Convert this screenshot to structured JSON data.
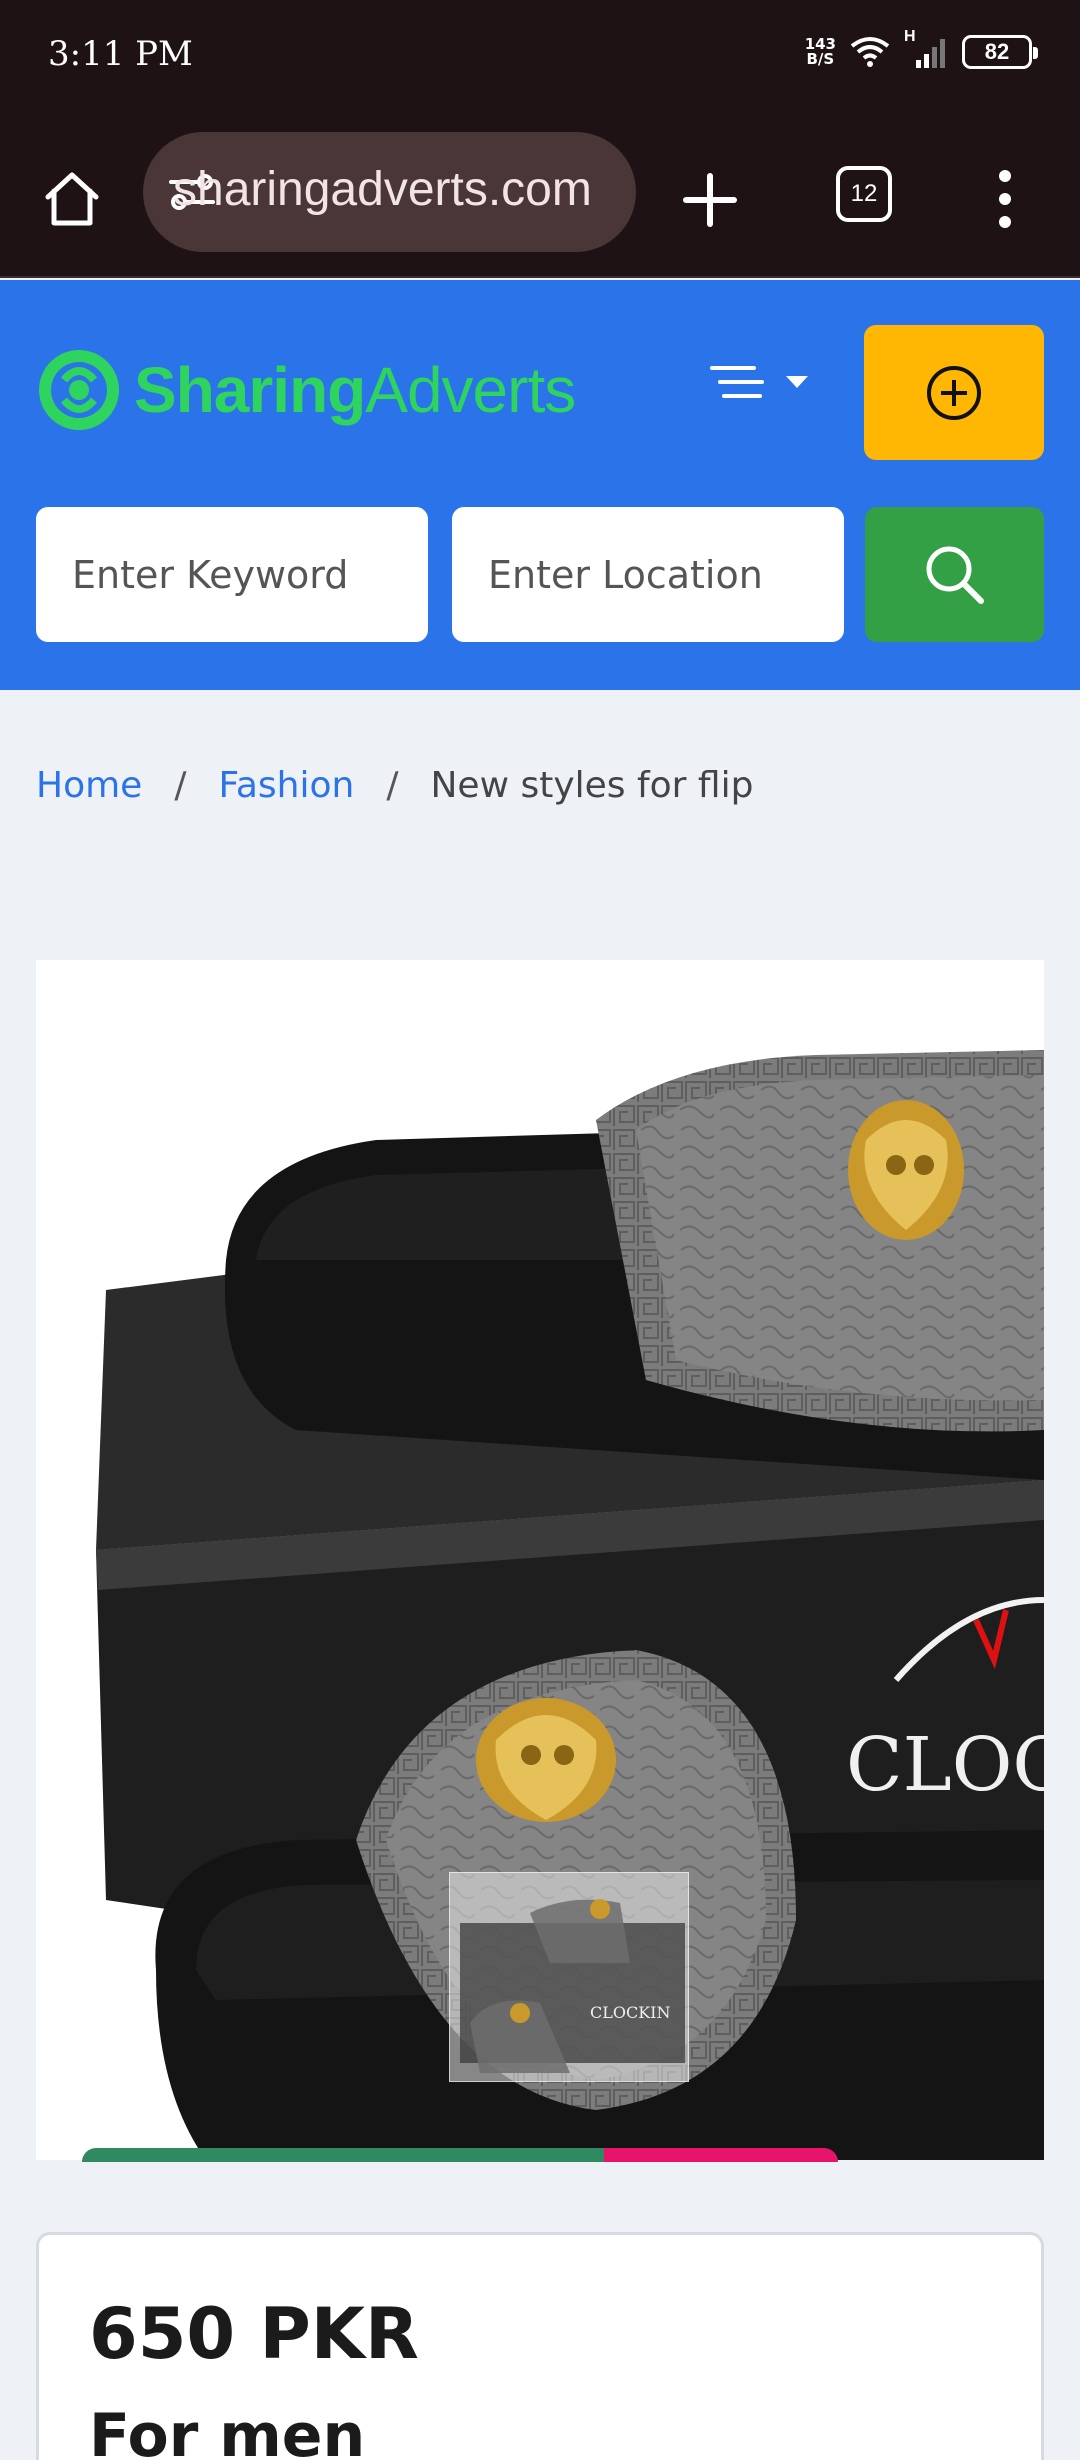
{
  "status_bar": {
    "time": "3:11 PM",
    "net_speed_value": "143",
    "net_speed_unit": "B/S",
    "network_type": "H",
    "battery": "82"
  },
  "browser": {
    "url": "sharingadverts.com",
    "tab_count": "12"
  },
  "header": {
    "logo_part1": "Sharing",
    "logo_part2": "Adverts",
    "keyword_placeholder": "Enter Keyword",
    "location_placeholder": "Enter Location",
    "colors": {
      "header_bg": "#2a73e8",
      "post_button": "#ffb703",
      "search_button": "#34a045",
      "logo_green": "#2fd45f"
    }
  },
  "breadcrumb": {
    "home": "Home",
    "category": "Fashion",
    "current": "New styles for flip"
  },
  "product_image": {
    "thumbnail_brand": "CLOCKIN",
    "box_brand": "CLOCKIN"
  },
  "listing": {
    "price": "650 PKR",
    "title": "For men"
  }
}
